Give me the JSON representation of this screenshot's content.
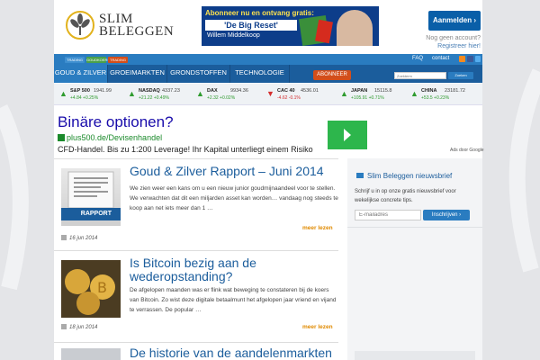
{
  "header": {
    "logo_line1": "SLIM",
    "logo_line2": "BELEGGEN",
    "banner": {
      "headline": "Abonneer nu en ontvang gratis:",
      "book_title": "'De Big Reset'",
      "author": "Willem Middelkoop"
    },
    "login_label": "Aanmelden",
    "no_account": "Nog geen account?",
    "register": "Registreer hier!"
  },
  "topbar": {
    "pills": [
      "TRADING",
      "GOUDKOERS",
      "TRADING"
    ],
    "faq": "FAQ",
    "contact": "contact"
  },
  "nav": {
    "items": [
      "GOUD & ZILVER",
      "GROEIMARKTEN",
      "GRONDSTOFFEN",
      "TECHNOLOGIE"
    ],
    "subscribe": "ABONNEER",
    "search_placeholder": "Zoekterm",
    "search_button": "Zoeken"
  },
  "ticker": [
    {
      "name": "S&P 500",
      "value": "1941.99",
      "change": "+4.84 +0.25%",
      "dir": "up"
    },
    {
      "name": "NASDAQ",
      "value": "4337.23",
      "change": "+21.22 +0.49%",
      "dir": "up"
    },
    {
      "name": "DAX",
      "value": "9934.36",
      "change": "+2.32 +0.02%",
      "dir": "up"
    },
    {
      "name": "CAC 40",
      "value": "4536.01",
      "change": "-4.62 -0.1%",
      "dir": "down"
    },
    {
      "name": "JAPAN",
      "value": "15115.8",
      "change": "+105.91 +0.71%",
      "dir": "up"
    },
    {
      "name": "CHINA",
      "value": "23181.72",
      "change": "+53.5 +0.23%",
      "dir": "up"
    }
  ],
  "ad": {
    "title": "Binäre optionen?",
    "url": "plus500.de/Devisenhandel",
    "text": "CFD-Handel. Bis zu 1:200 Leverage! Ihr Kapital unterliegt einem Risiko",
    "by": "Ads door Google"
  },
  "articles": [
    {
      "title": "Goud & Zilver Rapport – Juni 2014",
      "excerpt": "We zien weer een kans om u een nieuw junior goudmijnaandeel voor te stellen. We verwachten dat dit een miljarden asset kan worden… vandaag nog steeds te koop aan net iets meer dan 1 …",
      "date": "16 jun 2014",
      "more": "meer lezen",
      "thumb_label": "RAPPORT"
    },
    {
      "title_line1": "Is Bitcoin bezig aan de",
      "title_line2": "wederopstanding?",
      "excerpt": "De afgelopen maanden was er flink wat beweging te constateren bij de koers van Bitcoin. Zo wist deze digitale betaalmunt het afgelopen jaar vriend en vijand te verrassen. De popular …",
      "date": "18 jun 2014",
      "more": "meer lezen"
    },
    {
      "title": "De historie van de aandelenmarkten"
    }
  ],
  "sidebar": {
    "title": "Slim Beleggen nieuwsbrief",
    "text": "Schrijf u in op onze gratis nieuwsbrief voor wekelijkse concrete tips.",
    "email_placeholder": "E-mailadres",
    "subscribe_button": "Inschrijven"
  },
  "colors": {
    "nav_blue": "#1b5d9c",
    "accent_orange": "#d34e1a",
    "link_blue": "#1a0dab",
    "up_green": "#2e9b2e",
    "down_red": "#d42d2d"
  }
}
